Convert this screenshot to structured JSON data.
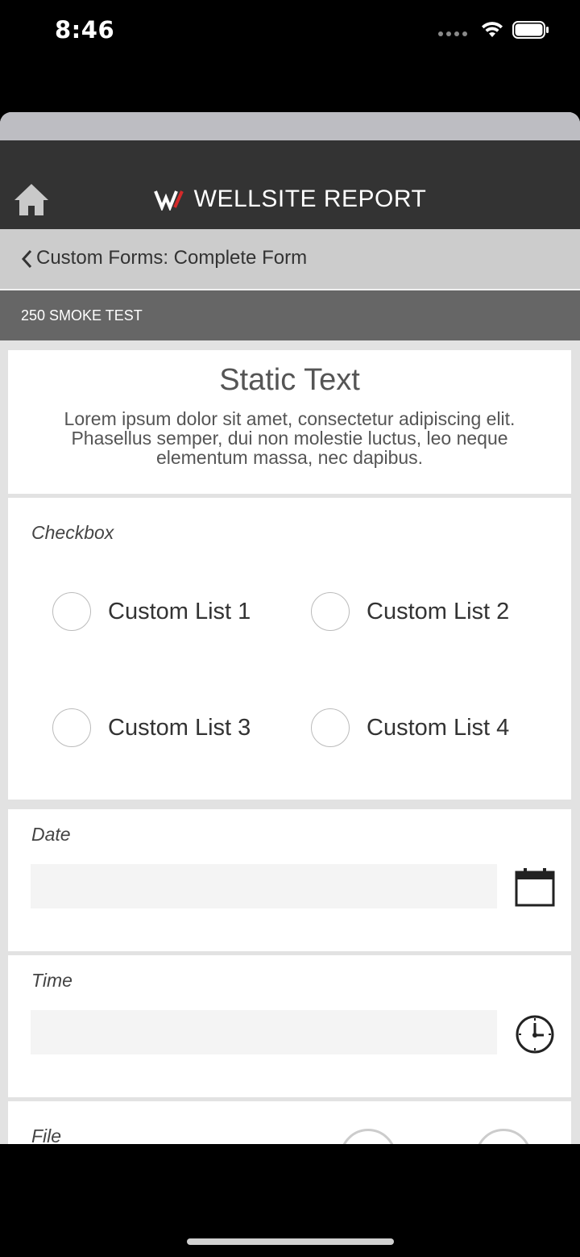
{
  "status_bar": {
    "time": "8:46"
  },
  "header": {
    "brand": "WELLSITE REPORT"
  },
  "nav": {
    "title": "Custom Forms: Complete Form"
  },
  "section": {
    "title": "250 SMOKE TEST"
  },
  "static_text": {
    "title": "Static Text",
    "body": "Lorem ipsum dolor sit amet, consectetur adipiscing elit. Phasellus semper, dui non molestie luctus, leo neque elementum massa, nec dapibus."
  },
  "checkbox": {
    "label": "Checkbox",
    "options": [
      "Custom List 1",
      "Custom List 2",
      "Custom List 3",
      "Custom List 4"
    ]
  },
  "date": {
    "label": "Date",
    "value": ""
  },
  "time": {
    "label": "Time",
    "value": ""
  },
  "file": {
    "label": "File"
  }
}
